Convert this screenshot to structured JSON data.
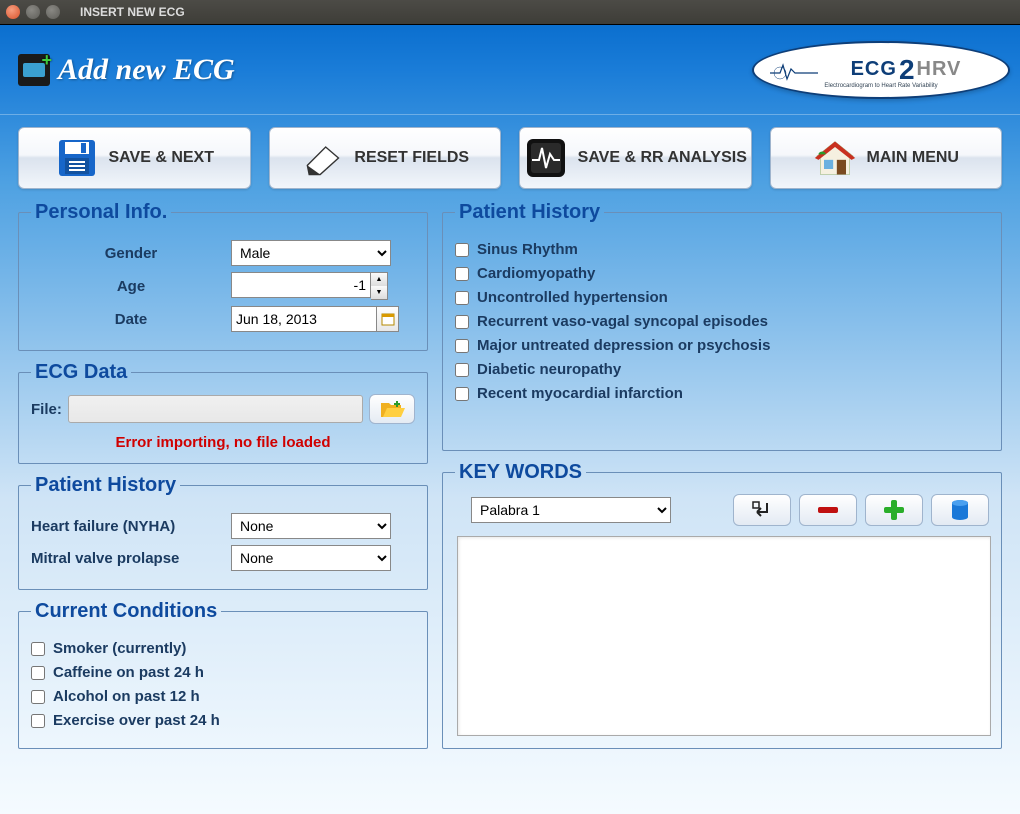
{
  "window": {
    "title": "INSERT NEW ECG"
  },
  "header": {
    "title": "Add new ECG",
    "logo_main": "ECG",
    "logo_2": "2",
    "logo_hrv": "HRV",
    "logo_sub": "Electrocardiogram to Heart Rate Variability"
  },
  "toolbar": {
    "save_next": "SAVE & NEXT",
    "reset": "RESET FIELDS",
    "save_rr": "SAVE & RR ANALYSIS",
    "main_menu": "MAIN MENU"
  },
  "personal": {
    "legend": "Personal Info.",
    "gender_label": "Gender",
    "gender_value": "Male",
    "age_label": "Age",
    "age_value": "-1",
    "date_label": "Date",
    "date_value": "Jun 18, 2013"
  },
  "ecg": {
    "legend": "ECG Data",
    "file_label": "File:",
    "error": "Error importing, no file loaded"
  },
  "history_left": {
    "legend": "Patient History",
    "hf_label": "Heart failure (NYHA)",
    "hf_value": "None",
    "mvp_label": "Mitral valve prolapse",
    "mvp_value": "None"
  },
  "conditions": {
    "legend": "Current Conditions",
    "items": [
      "Smoker (currently)",
      "Caffeine on past 24 h",
      "Alcohol on past 12 h",
      "Exercise over past 24 h"
    ]
  },
  "history_right": {
    "legend": "Patient History",
    "items": [
      "Sinus Rhythm",
      "Cardiomyopathy",
      " Uncontrolled hypertension",
      "Recurrent vaso-vagal syncopal episodes",
      "Major untreated depression or psychosis",
      "Diabetic neuropathy",
      "Recent myocardial infarction"
    ]
  },
  "keywords": {
    "legend": "KEY WORDS",
    "selected": "Palabra 1"
  }
}
